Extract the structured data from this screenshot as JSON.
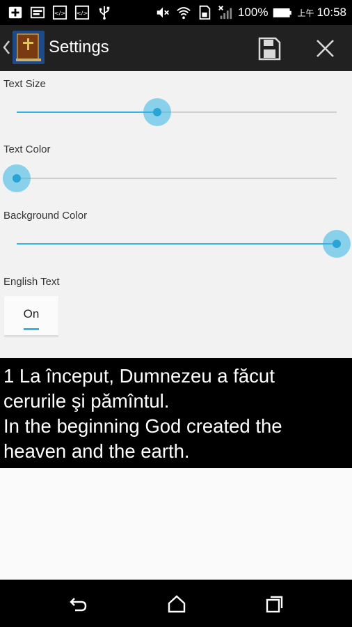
{
  "status_bar": {
    "icons_left": [
      "add-icon",
      "image-icon",
      "code-icon",
      "code-icon",
      "usb-icon"
    ],
    "icons_right": [
      "mute-icon",
      "wifi-icon",
      "sd-card-icon",
      "no-signal-icon",
      "battery-icon"
    ],
    "battery_percent": "100%",
    "time_prefix": "上午",
    "time": "10:58"
  },
  "action_bar": {
    "title": "Settings",
    "logo_icon": "bible-icon",
    "actions": [
      "save-icon",
      "close-icon"
    ]
  },
  "settings": {
    "text_size": {
      "label": "Text Size",
      "value": 0.44
    },
    "text_color": {
      "label": "Text Color",
      "value": 0.0
    },
    "background_color": {
      "label": "Background Color",
      "value": 1.0
    },
    "english_text": {
      "label": "English Text",
      "toggle_label": "On",
      "checked": true
    },
    "accent_color": "#33b5e5"
  },
  "preview": {
    "lines": [
      "1 La început, Dumnezeu a făcut",
      "cerurile şi pămîntul.",
      "In the beginning God created the",
      "heaven and the earth."
    ],
    "background": "#000000",
    "text_color": "#ffffff"
  },
  "nav_bar": {
    "buttons": [
      "back-icon",
      "home-icon",
      "recent-apps-icon"
    ]
  }
}
